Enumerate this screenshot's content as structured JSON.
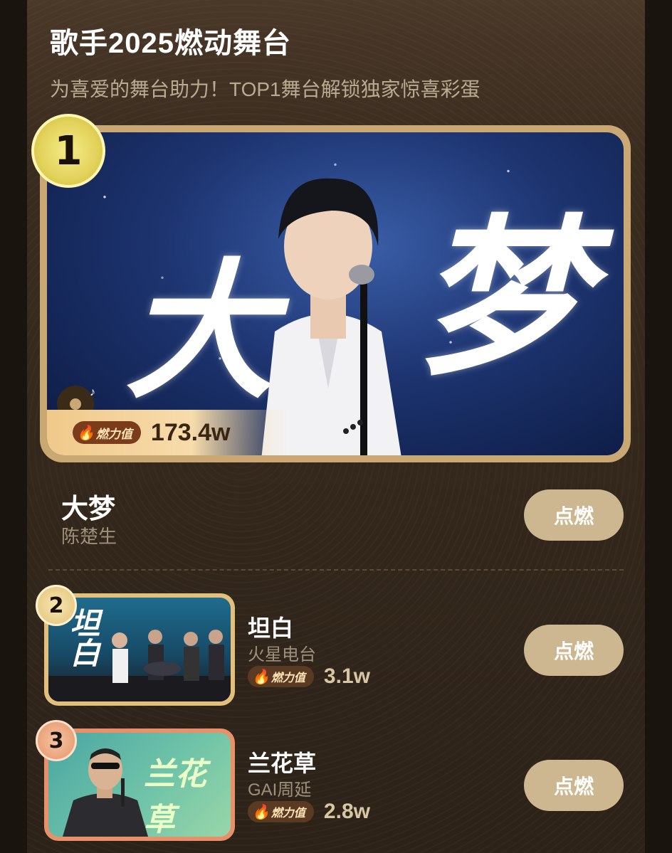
{
  "header": {
    "title": "歌手2025燃动舞台",
    "subtitle": "为喜爱的舞台助力！TOP1舞台解锁独家惊喜彩蛋"
  },
  "fire_label": "燃力值",
  "colors": {
    "gold": "#c9a873",
    "button": "#cdb791",
    "rank2": "#e2c07c",
    "rank3": "#e8906a"
  },
  "ranking": [
    {
      "rank": "1",
      "song": "大梦",
      "artist": "陈楚生",
      "fire_value": "173.4w",
      "button": "点燃",
      "cover_text_left": "大",
      "cover_text_right": "梦"
    },
    {
      "rank": "2",
      "song": "坦白",
      "artist": "火星电台",
      "fire_value": "3.1w",
      "button": "点燃",
      "cover_text": "坦白"
    },
    {
      "rank": "3",
      "song": "兰花草",
      "artist": "GAI周延",
      "fire_value": "2.8w",
      "button": "点燃",
      "cover_text": "兰花草"
    }
  ]
}
